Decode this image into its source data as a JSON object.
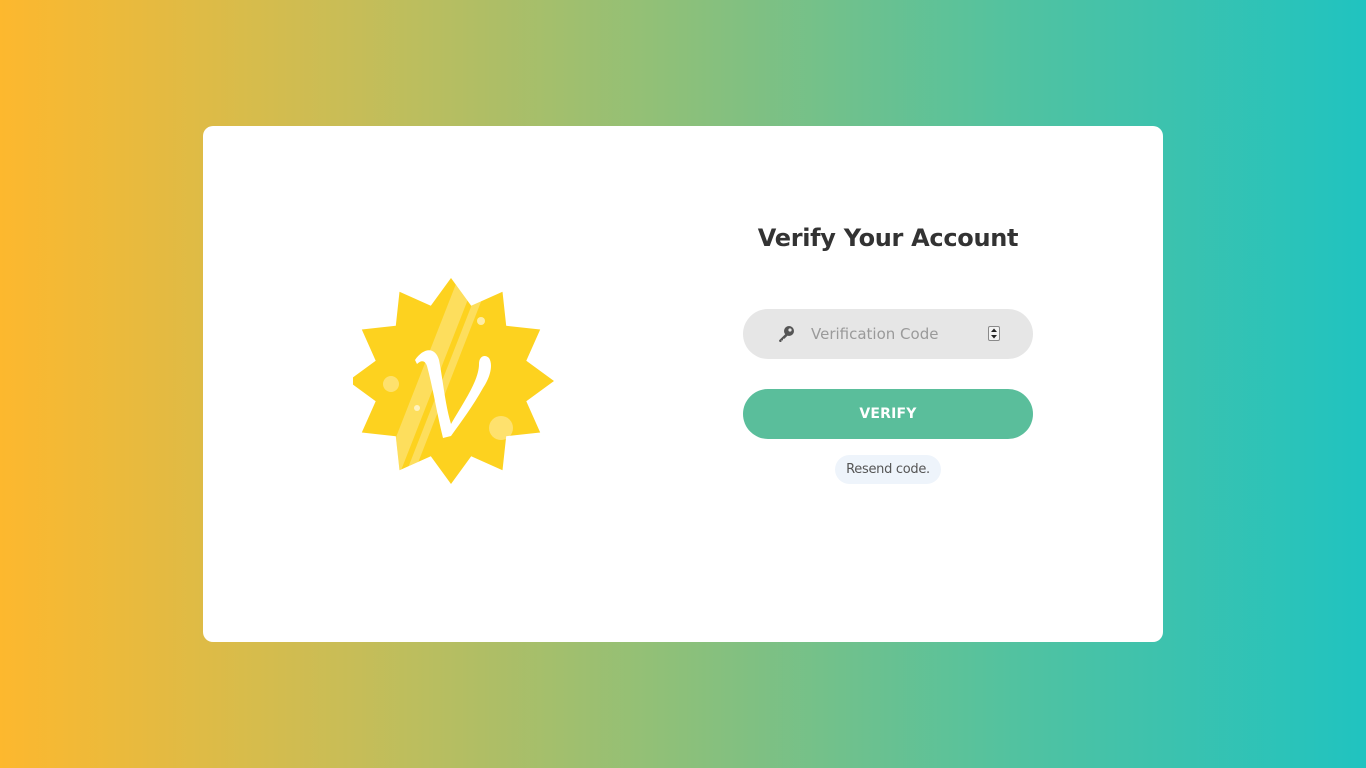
{
  "page": {
    "title": "Verify Your Account"
  },
  "logo": {
    "icon": "verified-v-badge-icon",
    "letter": "v",
    "color": "#fdd21f"
  },
  "form": {
    "code_field": {
      "placeholder": "Verification Code",
      "value": "",
      "icon": "key-icon"
    },
    "verify_button_label": "VERIFY",
    "resend_link_label": "Resend code."
  },
  "colors": {
    "background_gradient": [
      "#fdb82e",
      "#8cc07a",
      "#20c3c0"
    ],
    "card": "#ffffff",
    "button": "#5abe9b",
    "field": "#e6e6e6",
    "title": "#333333"
  }
}
